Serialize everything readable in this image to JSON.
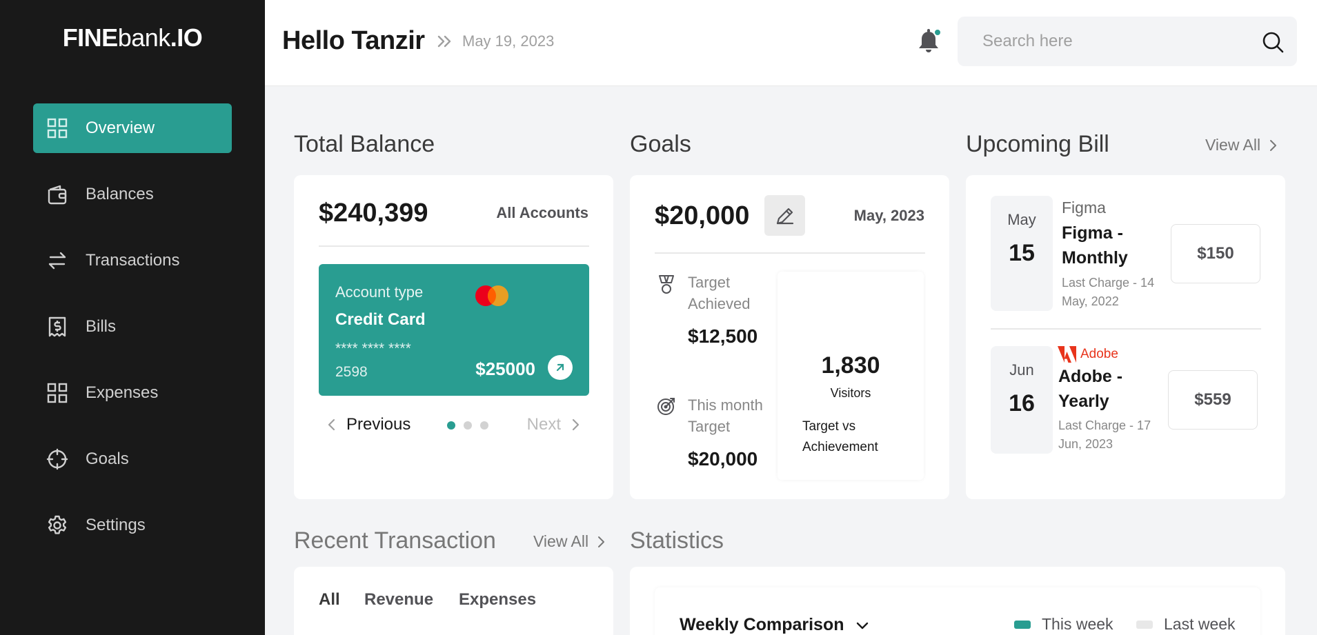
{
  "app": {
    "logo_bold": "FINE",
    "logo_mid": "bank",
    "logo_tail": ".IO"
  },
  "sidebar": {
    "items": [
      {
        "label": "Overview",
        "icon": "grid-icon",
        "active": true
      },
      {
        "label": "Balances",
        "icon": "wallet-icon"
      },
      {
        "label": "Transactions",
        "icon": "transfer-icon"
      },
      {
        "label": "Bills",
        "icon": "bill-icon"
      },
      {
        "label": "Expenses",
        "icon": "grid-icon"
      },
      {
        "label": "Goals",
        "icon": "crosshair-icon"
      },
      {
        "label": "Settings",
        "icon": "gear-icon"
      }
    ]
  },
  "header": {
    "greeting": "Hello Tanzir",
    "date": "May 19, 2023",
    "search_placeholder": "Search here"
  },
  "total_balance": {
    "title": "Total Balance",
    "amount": "$240,399",
    "accounts_label": "All Accounts",
    "card": {
      "type_label": "Account type",
      "name": "Credit Card",
      "number_masked": "**** **** ****",
      "number_last": "2598",
      "balance": "$25000"
    },
    "prev_label": "Previous",
    "next_label": "Next",
    "active_page": 1,
    "page_count": 3
  },
  "goals": {
    "title": "Goals",
    "amount": "$20,000",
    "date": "May, 2023",
    "achieved_label": "Target Achieved",
    "achieved_value": "$12,500",
    "target_label": "This month Target",
    "target_value": "$20,000",
    "visitors_value": "1,830",
    "visitors_label": "Visitors",
    "chart_caption": "Target vs Achievement"
  },
  "upcoming_bill": {
    "title": "Upcoming Bill",
    "view_all": "View All",
    "bills": [
      {
        "month": "May",
        "day": "15",
        "brand": "Figma",
        "title": "Figma - Monthly",
        "meta": "Last Charge - 14 May, 2022",
        "amount": "$150"
      },
      {
        "month": "Jun",
        "day": "16",
        "brand": "Adobe",
        "title": "Adobe - Yearly",
        "meta": "Last Charge - 17 Jun, 2023",
        "amount": "$559"
      }
    ]
  },
  "recent_transaction": {
    "title": "Recent Transaction",
    "view_all": "View All",
    "tabs": [
      "All",
      "Revenue",
      "Expenses"
    ]
  },
  "statistics": {
    "title": "Statistics",
    "selector": "Weekly Comparison",
    "legend": [
      {
        "label": "This week",
        "color": "#299d91"
      },
      {
        "label": "Last week",
        "color": "#e8e8e8"
      }
    ]
  },
  "colors": {
    "accent": "#299d91",
    "sidebar": "#191919",
    "notification_dot": "#299d91",
    "adobe": "#e8341c"
  }
}
